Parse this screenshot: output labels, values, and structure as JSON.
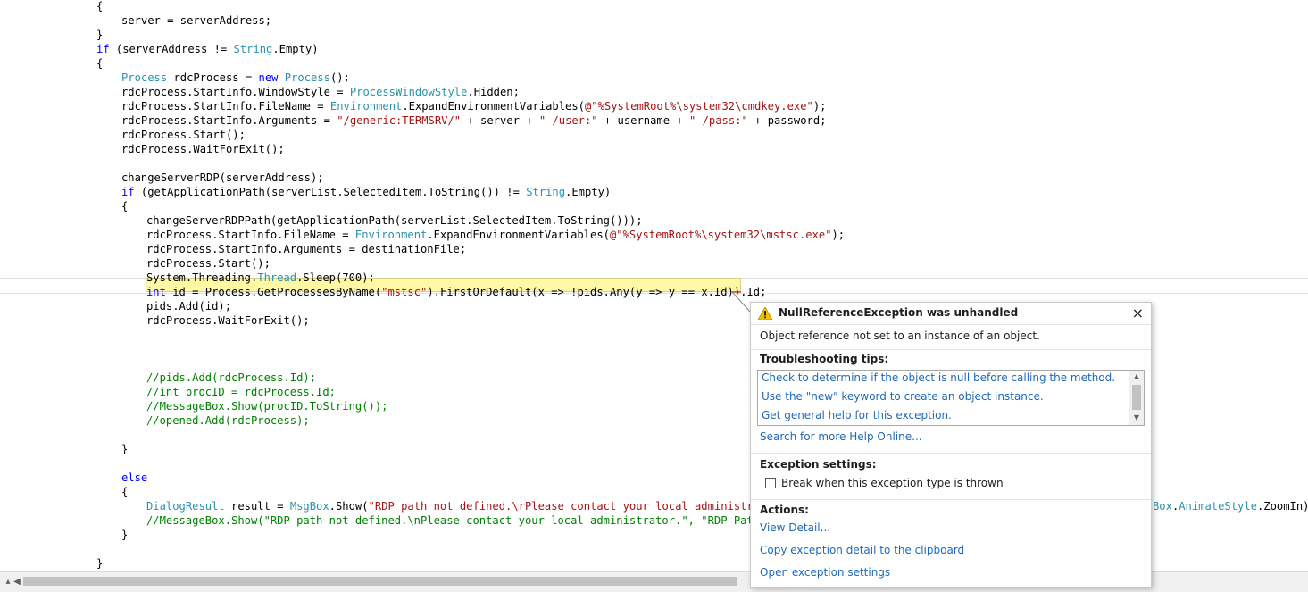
{
  "code": {
    "lines": [
      {
        "indent": 0,
        "tokens": [
          {
            "c": "plain",
            "t": "{"
          }
        ]
      },
      {
        "indent": 1,
        "tokens": [
          {
            "c": "plain",
            "t": "server = serverAddress;"
          }
        ]
      },
      {
        "indent": 0,
        "tokens": [
          {
            "c": "plain",
            "t": "}"
          }
        ]
      },
      {
        "indent": 0,
        "tokens": [
          {
            "c": "kw",
            "t": "if"
          },
          {
            "c": "plain",
            "t": " (serverAddress != "
          },
          {
            "c": "type",
            "t": "String"
          },
          {
            "c": "plain",
            "t": ".Empty)"
          }
        ]
      },
      {
        "indent": 0,
        "tokens": [
          {
            "c": "plain",
            "t": "{"
          }
        ]
      },
      {
        "indent": 1,
        "tokens": [
          {
            "c": "type",
            "t": "Process"
          },
          {
            "c": "plain",
            "t": " rdcProcess = "
          },
          {
            "c": "kw",
            "t": "new"
          },
          {
            "c": "plain",
            "t": " "
          },
          {
            "c": "type",
            "t": "Process"
          },
          {
            "c": "plain",
            "t": "();"
          }
        ]
      },
      {
        "indent": 1,
        "tokens": [
          {
            "c": "plain",
            "t": "rdcProcess.StartInfo.WindowStyle = "
          },
          {
            "c": "type",
            "t": "ProcessWindowStyle"
          },
          {
            "c": "plain",
            "t": ".Hidden;"
          }
        ]
      },
      {
        "indent": 1,
        "tokens": [
          {
            "c": "plain",
            "t": "rdcProcess.StartInfo.FileName = "
          },
          {
            "c": "type",
            "t": "Environment"
          },
          {
            "c": "plain",
            "t": ".ExpandEnvironmentVariables("
          },
          {
            "c": "str",
            "t": "@\"%SystemRoot%\\system32\\cmdkey.exe\""
          },
          {
            "c": "plain",
            "t": ");"
          }
        ]
      },
      {
        "indent": 1,
        "tokens": [
          {
            "c": "plain",
            "t": "rdcProcess.StartInfo.Arguments = "
          },
          {
            "c": "str",
            "t": "\"/generic:TERMSRV/\""
          },
          {
            "c": "plain",
            "t": " + server + "
          },
          {
            "c": "str",
            "t": "\" /user:\""
          },
          {
            "c": "plain",
            "t": " + username + "
          },
          {
            "c": "str",
            "t": "\" /pass:\""
          },
          {
            "c": "plain",
            "t": " + password;"
          }
        ]
      },
      {
        "indent": 1,
        "tokens": [
          {
            "c": "plain",
            "t": "rdcProcess.Start();"
          }
        ]
      },
      {
        "indent": 1,
        "tokens": [
          {
            "c": "plain",
            "t": "rdcProcess.WaitForExit();"
          }
        ]
      },
      {
        "indent": 1,
        "tokens": []
      },
      {
        "indent": 1,
        "tokens": [
          {
            "c": "plain",
            "t": "changeServerRDP(serverAddress);"
          }
        ]
      },
      {
        "indent": 1,
        "tokens": [
          {
            "c": "kw",
            "t": "if"
          },
          {
            "c": "plain",
            "t": " (getApplicationPath(serverList.SelectedItem.ToString()) != "
          },
          {
            "c": "type",
            "t": "String"
          },
          {
            "c": "plain",
            "t": ".Empty)"
          }
        ]
      },
      {
        "indent": 1,
        "tokens": [
          {
            "c": "plain",
            "t": "{"
          }
        ]
      },
      {
        "indent": 2,
        "tokens": [
          {
            "c": "plain",
            "t": "changeServerRDPPath(getApplicationPath(serverList.SelectedItem.ToString()));"
          }
        ]
      },
      {
        "indent": 2,
        "tokens": [
          {
            "c": "plain",
            "t": "rdcProcess.StartInfo.FileName = "
          },
          {
            "c": "type",
            "t": "Environment"
          },
          {
            "c": "plain",
            "t": ".ExpandEnvironmentVariables("
          },
          {
            "c": "str",
            "t": "@\"%SystemRoot%\\system32\\mstsc.exe\""
          },
          {
            "c": "plain",
            "t": ");"
          }
        ]
      },
      {
        "indent": 2,
        "tokens": [
          {
            "c": "plain",
            "t": "rdcProcess.StartInfo.Arguments = destinationFile;"
          }
        ]
      },
      {
        "indent": 2,
        "tokens": [
          {
            "c": "plain",
            "t": "rdcProcess.Start();"
          }
        ]
      },
      {
        "indent": 2,
        "tokens": [
          {
            "c": "plain",
            "t": "System.Threading."
          },
          {
            "c": "type",
            "t": "Thread"
          },
          {
            "c": "plain",
            "t": ".Sleep(700);"
          }
        ]
      },
      {
        "indent": 2,
        "tokens": [
          {
            "c": "kw",
            "t": "int"
          },
          {
            "c": "plain",
            "t": " id = Process.GetProcessesByName("
          },
          {
            "c": "str",
            "t": "\"mstsc\""
          },
          {
            "c": "plain",
            "t": ").FirstOrDefault(x => !pids.Any(y => y == x.Id)).Id;"
          }
        ]
      },
      {
        "indent": 2,
        "tokens": [
          {
            "c": "plain",
            "t": "pids.Add(id);"
          }
        ]
      },
      {
        "indent": 2,
        "tokens": [
          {
            "c": "plain",
            "t": "rdcProcess.WaitForExit();"
          }
        ]
      },
      {
        "indent": 2,
        "tokens": []
      },
      {
        "indent": 2,
        "tokens": []
      },
      {
        "indent": 2,
        "tokens": []
      },
      {
        "indent": 2,
        "tokens": [
          {
            "c": "comment",
            "t": "//pids.Add(rdcProcess.Id);"
          }
        ]
      },
      {
        "indent": 2,
        "tokens": [
          {
            "c": "comment",
            "t": "//int procID = rdcProcess.Id;"
          }
        ]
      },
      {
        "indent": 2,
        "tokens": [
          {
            "c": "comment",
            "t": "//MessageBox.Show(procID.ToString());"
          }
        ]
      },
      {
        "indent": 2,
        "tokens": [
          {
            "c": "comment",
            "t": "//opened.Add(rdcProcess);"
          }
        ]
      },
      {
        "indent": 2,
        "tokens": []
      },
      {
        "indent": 1,
        "tokens": [
          {
            "c": "plain",
            "t": "}"
          }
        ]
      },
      {
        "indent": 1,
        "tokens": []
      },
      {
        "indent": 1,
        "tokens": [
          {
            "c": "kw",
            "t": "else"
          }
        ]
      },
      {
        "indent": 1,
        "tokens": [
          {
            "c": "plain",
            "t": "{"
          }
        ]
      },
      {
        "indent": 2,
        "tokens": [
          {
            "c": "type",
            "t": "DialogResult"
          },
          {
            "c": "plain",
            "t": " result = "
          },
          {
            "c": "type",
            "t": "MsgBox"
          },
          {
            "c": "plain",
            "t": ".Show("
          },
          {
            "c": "str",
            "t": "\"RDP path not defined.\\rPlease contact your local administrator"
          }
        ]
      },
      {
        "indent": 2,
        "tokens": [
          {
            "c": "comment",
            "t": "//MessageBox.Show(\"RDP path not defined.\\nPlease contact your local administrator.\", \"RDP Path Mi"
          }
        ]
      },
      {
        "indent": 1,
        "tokens": [
          {
            "c": "plain",
            "t": "}"
          }
        ]
      },
      {
        "indent": 1,
        "tokens": []
      },
      {
        "indent": 0,
        "tokens": [
          {
            "c": "plain",
            "t": "}"
          }
        ]
      }
    ],
    "overflow_tail": [
      {
        "c": "type",
        "t": "Box"
      },
      {
        "c": "plain",
        "t": "."
      },
      {
        "c": "type",
        "t": "AnimateStyle"
      },
      {
        "c": "plain",
        "t": ".ZoomIn);"
      }
    ]
  },
  "exception": {
    "title": "NullReferenceException was unhandled",
    "message": "Object reference not set to an instance of an object.",
    "troubleshooting_header": "Troubleshooting tips:",
    "tips": [
      "Check to determine if the object is null before calling the method.",
      "Use the \"new\" keyword to create an object instance.",
      "Get general help for this exception."
    ],
    "search_link": "Search for more Help Online...",
    "settings_header": "Exception settings:",
    "checkbox_label": "Break when this exception type is thrown",
    "checkbox_checked": false,
    "actions_header": "Actions:",
    "actions": [
      "View Detail...",
      "Copy exception detail to the clipboard",
      "Open exception settings"
    ],
    "close_glyph": "×",
    "warning_icon": "warning-triangle-icon"
  },
  "colors": {
    "keyword": "#0000ff",
    "type": "#2b91af",
    "string": "#a31515",
    "comment": "#008000",
    "link": "#1e6ab8",
    "highlight": "#fff9a6"
  }
}
